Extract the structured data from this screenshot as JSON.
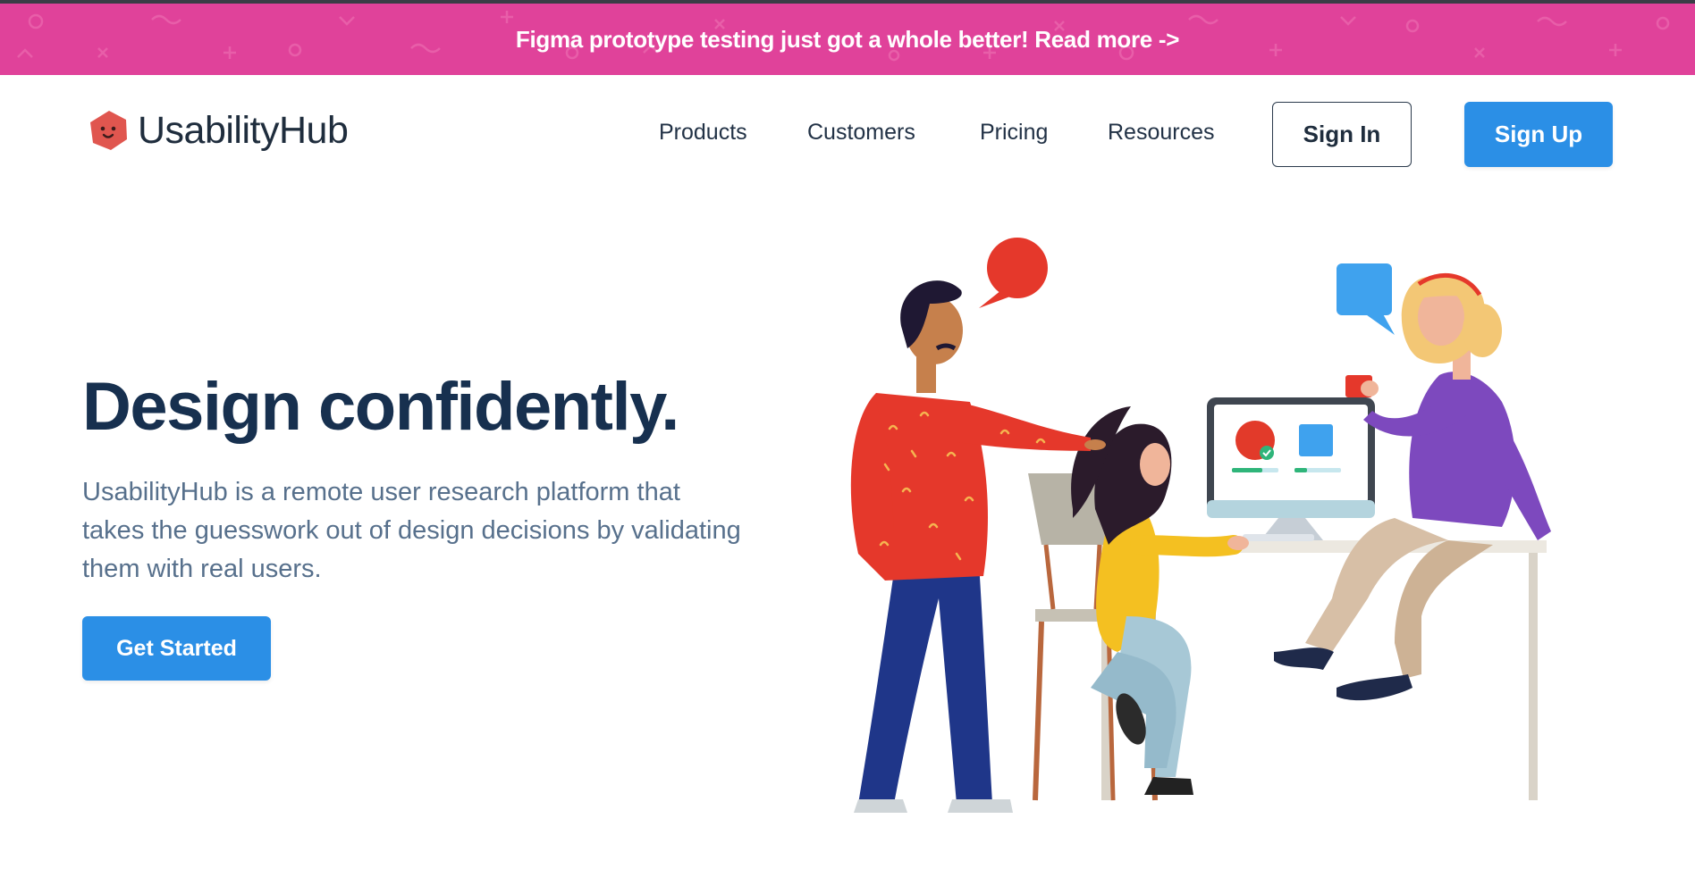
{
  "banner": {
    "text": "Figma prototype testing just got a whole better! Read more ->",
    "color": "#e0429a"
  },
  "header": {
    "logo_text": "UsabilityHub",
    "logo_icon": "hexagon-face-icon",
    "nav": [
      {
        "label": "Products"
      },
      {
        "label": "Customers"
      },
      {
        "label": "Pricing"
      },
      {
        "label": "Resources"
      }
    ],
    "sign_in": "Sign In",
    "sign_up": "Sign Up"
  },
  "hero": {
    "title": "Design confidently.",
    "subtitle": "UsabilityHub is a remote user research platform that takes the guesswork out of design decisions by validating them with real users.",
    "cta": "Get Started"
  },
  "colors": {
    "accent": "#2b8fe6",
    "heading": "#17304f",
    "body_text": "#57708c",
    "brand_red": "#e0564f"
  }
}
